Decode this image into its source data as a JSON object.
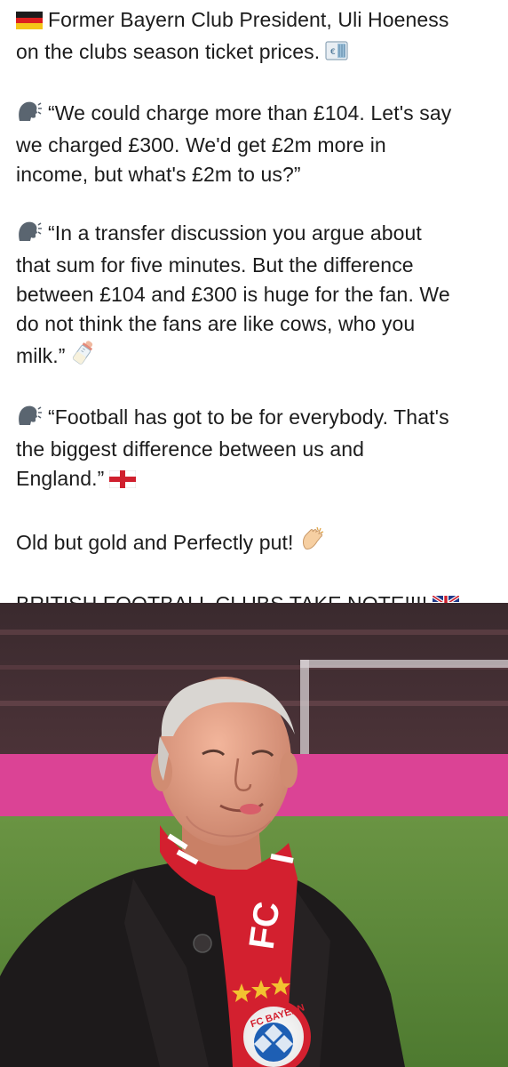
{
  "post": {
    "paragraphs": [
      {
        "emoji": "germany-flag-icon",
        "lines": [
          "Former Bayern Club President, Uli Hoeness",
          "on the clubs season ticket prices."
        ],
        "trailing_emoji": "euro-banknote-icon"
      },
      {
        "emoji": "speaking-head-icon",
        "lines": [
          "“We could charge more than £104. Let's say",
          "we charged £300. We'd get £2m more in",
          "income, but what's £2m to us?”"
        ]
      },
      {
        "emoji": "speaking-head-icon",
        "lines": [
          "“In a transfer discussion you argue about",
          "that sum for five minutes. But the difference",
          "between £104 and £300 is huge for the fan. We",
          "do not think the fans are like cows, who you",
          "milk.”"
        ],
        "trailing_emoji": "baby-bottle-icon"
      },
      {
        "emoji": "speaking-head-icon",
        "lines": [
          "“Football has got to be for everybody. That's",
          "the biggest difference between us and",
          "England.”"
        ],
        "trailing_emoji": "england-flag-icon"
      },
      {
        "lines": [
          "Old but gold and Perfectly put!"
        ],
        "trailing_emoji": "clapping-hands-icon"
      },
      {
        "lines": [
          "BRITISH FOOTBALL CLUBS TAKE NOTE!!!!"
        ],
        "trailing_emoji": "uk-flag-icon"
      }
    ]
  },
  "photo": {
    "subject": "man-in-red-scarf-photo",
    "scarf_text": "FC",
    "badge_text": "FC BAYERN",
    "colors": {
      "scarf_red": "#d3202f",
      "coat": "#1d1a1b",
      "pitch": "#5f8a3c",
      "board_pink": "#d8338d"
    }
  }
}
